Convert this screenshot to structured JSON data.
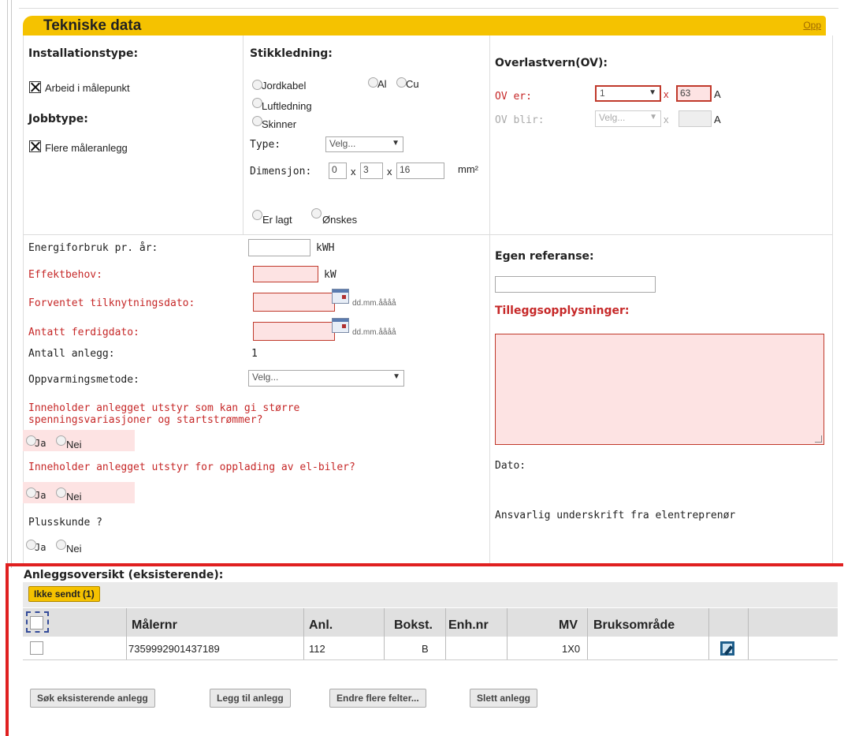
{
  "section": {
    "title": "Tekniske data",
    "top_link": "Opp"
  },
  "installation": {
    "heading": "Installationstype:",
    "option_label": "Arbeid i målepunkt",
    "jobtype_heading": "Jobbtype:",
    "jobtype_option": "Flere måleranlegg"
  },
  "stikk": {
    "heading": "Stikkledning:",
    "jordkabel": "Jordkabel",
    "al": "Al",
    "cu": "Cu",
    "luftledning": "Luftledning",
    "skinner": "Skinner",
    "type_label": "Type:",
    "type_value": "Velg...",
    "dim_label": "Dimensjon:",
    "dim1": "0",
    "x1": "x",
    "dim2": "3",
    "x2": "x",
    "dim3": "16",
    "unit": "mm²",
    "er_lagt": "Er lagt",
    "onskes": "Ønskes"
  },
  "ov": {
    "heading": "Overlastvern(OV):",
    "er_label": "OV er:",
    "er_value": "1",
    "x": "x",
    "er_amp": "63",
    "a": "A",
    "blir_label": "OV blir:",
    "blir_value": "Velg...",
    "blir_a": "A"
  },
  "energy": {
    "forbruk_label": "Energiforbruk pr. år:",
    "forbruk_unit": "kWH",
    "effekt_label": "Effektbehov:",
    "effekt_unit": "kW",
    "tilk_label": "Forventet tilknytningsdato:",
    "date_format": "dd.mm.åååå",
    "ferdig_label": "Antatt ferdigdato:",
    "antall_label": "Antall anlegg:",
    "antall_value": "1",
    "oppv_label": "Oppvarmingsmetode:",
    "oppv_value": "Velg...",
    "q1": "Inneholder anlegget utstyr som kan gi større spenningsvariasjoner og startstrømmer?",
    "q2": "Inneholder anlegget utstyr for opplading av el-biler?",
    "q3": "Plusskunde ?",
    "ja": "Ja",
    "nei": "Nei"
  },
  "right": {
    "egen_ref": "Egen referanse:",
    "tillegg": "Tilleggsopplysninger:",
    "dato": "Dato:",
    "ansvarlig": "Ansvarlig underskrift fra elentreprenør"
  },
  "overview": {
    "heading": "Anleggsoversikt (eksisterende):",
    "tab_label": "Ikke sendt (1)",
    "columns": [
      "Målernr",
      "Anl.",
      "Bokst.",
      "Enh.nr",
      "MV",
      "Bruksområde"
    ],
    "rows": [
      {
        "malernr": "735999290143718​9",
        "anl": "112",
        "bokst": "B",
        "enhnr": "",
        "mv": "1X0",
        "bruk": ""
      }
    ]
  },
  "buttons": {
    "sok": "Søk eksisterende anlegg",
    "legg": "Legg til anlegg",
    "endre": "Endre flere felter...",
    "slett": "Slett anlegg"
  }
}
